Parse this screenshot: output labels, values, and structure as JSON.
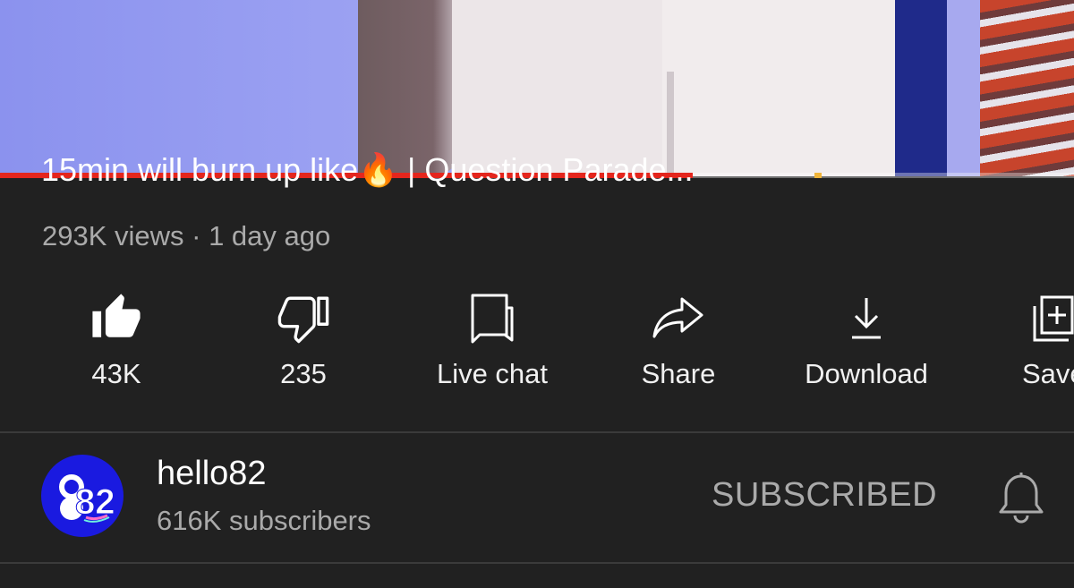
{
  "video": {
    "title": "15min will burn up like🔥 | Question Parade...",
    "progress_fraction": 0.645,
    "meta": "293K views · 1 day ago"
  },
  "actions": [
    {
      "id": "like",
      "label": "43K",
      "icon": "thumbs-up-filled-icon"
    },
    {
      "id": "dislike",
      "label": "235",
      "icon": "thumbs-down-icon"
    },
    {
      "id": "live-chat",
      "label": "Live chat",
      "icon": "chat-icon"
    },
    {
      "id": "share",
      "label": "Share",
      "icon": "share-arrow-icon"
    },
    {
      "id": "download",
      "label": "Download",
      "icon": "download-icon"
    },
    {
      "id": "save",
      "label": "Save",
      "icon": "playlist-add-icon"
    }
  ],
  "channel": {
    "name": "hello82",
    "subscribers": "616K subscribers",
    "subscribe_label": "SUBSCRIBED",
    "avatar_text": "82",
    "avatar_color": "#1a1ae0"
  },
  "colors": {
    "background": "#212121",
    "progress": "#e4261d",
    "secondary_text": "#aaaaaa"
  }
}
